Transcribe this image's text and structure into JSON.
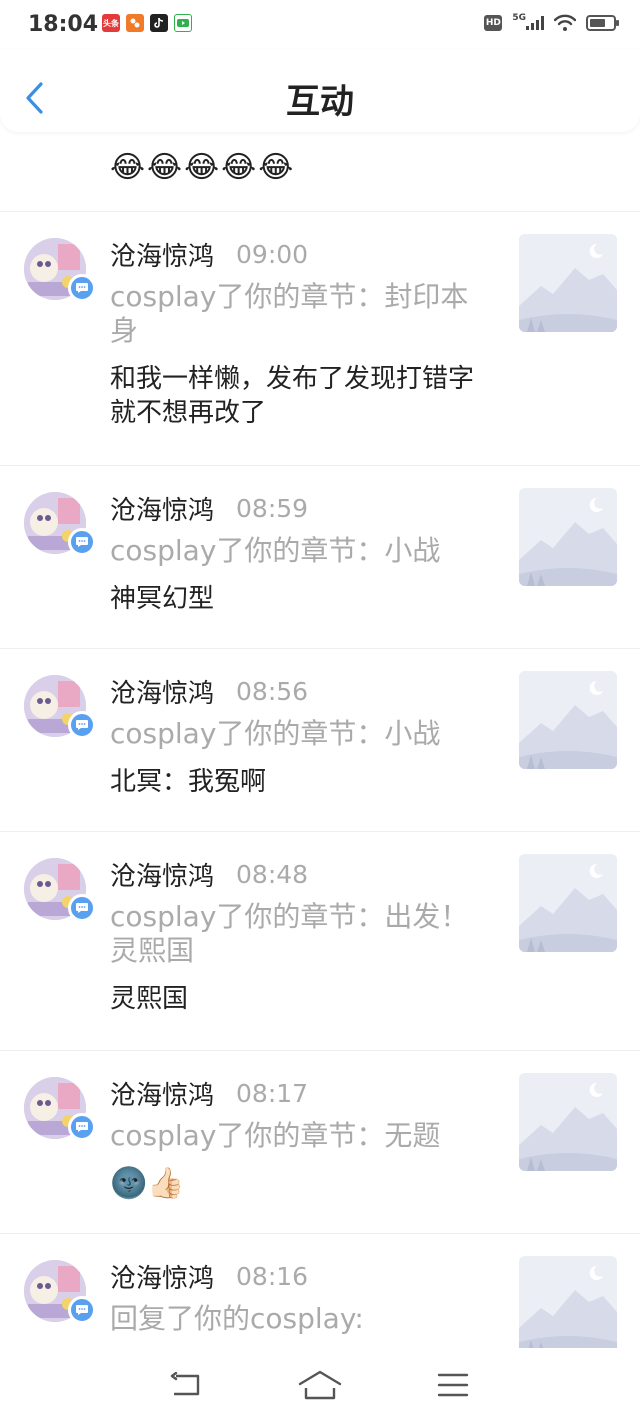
{
  "status": {
    "time": "18:04",
    "apps": [
      {
        "name": "toutiao-icon",
        "label": "头条",
        "color": "#e33b3b"
      },
      {
        "name": "app-orange-icon",
        "label": "",
        "color": "#f07a28"
      },
      {
        "name": "tiktok-icon",
        "label": "",
        "color": "#222222"
      },
      {
        "name": "iqiyi-icon",
        "label": "",
        "color": "#2fb14b"
      }
    ],
    "hd": "HD",
    "network": "5G",
    "battery_level": 0.7
  },
  "header": {
    "title": "互动"
  },
  "partial_item": {
    "emojis": "😂😂😂😂😂"
  },
  "items": [
    {
      "username": "沧海惊鸿",
      "time": "09:00",
      "desc": "cosplay了你的章节：封印本身",
      "comment": "和我一样懒，发布了发现打错字就不想再改了"
    },
    {
      "username": "沧海惊鸿",
      "time": "08:59",
      "desc": "cosplay了你的章节：小战",
      "comment": "神冥幻型"
    },
    {
      "username": "沧海惊鸿",
      "time": "08:56",
      "desc": "cosplay了你的章节：小战",
      "comment": "北冥：我冤啊"
    },
    {
      "username": "沧海惊鸿",
      "time": "08:48",
      "desc": "cosplay了你的章节：出发！灵熙国",
      "comment": "灵熙国"
    },
    {
      "username": "沧海惊鸿",
      "time": "08:17",
      "desc": "cosplay了你的章节：无题",
      "comment": "🌚👍🏻"
    },
    {
      "username": "沧海惊鸿",
      "time": "08:16",
      "desc": "回复了你的cosplay:",
      "comment": ""
    }
  ],
  "colors": {
    "accent": "#3a8ee6",
    "badge": "#5aa0f0",
    "muted_text": "#aaaaaa"
  }
}
